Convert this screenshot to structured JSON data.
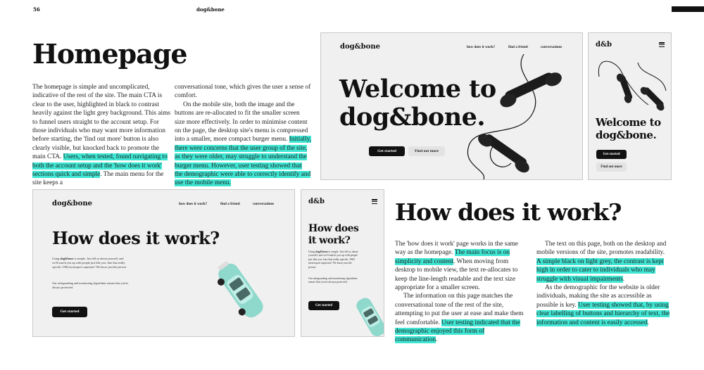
{
  "header": {
    "page_number": "56",
    "running_title": "dog&bone"
  },
  "homepage": {
    "heading": "Homepage",
    "col1": {
      "t1": "The homepage is simple and uncomplicated, indicative of the rest of the site. The main CTA is clear to the user, highlighted in black to contrast heavily against the light grey background. This aims to funnel users straight to the account setup. For those individuals who may want more information before starting, the 'find out more' button is also clearly visible, but knocked back to promote the main CTA. ",
      "h1": "Users, when tested, found navigating to both the account setup and the 'how does it work' sections quick and simple",
      "t2": ". The main menu for the site keeps a"
    },
    "col2": {
      "t1": "conversational tone, which gives the user a sense of comfort.",
      "t2": "On the mobile site, both the image and the buttons are re-allocated to fit the smaller screen size more effectively. In order to minimise content on the page, the desktop site's menu is compressed into a smaller, more compact burger menu. ",
      "h1": "Initially, there were concerns that the user group of the site, as they were older, may struggle to understand the burger menu. However, user testing showed that the demographic were able to correctly identify and use the mobile menu."
    }
  },
  "desktop_home": {
    "logo": "dog&bone",
    "nav": [
      "how does it work?",
      "find a friend",
      "conversations"
    ],
    "hero_line1": "Welcome to",
    "hero_line2": "dog&bone.",
    "primary": "Get started",
    "secondary": "Find out more"
  },
  "mobile_home": {
    "logo": "d&b",
    "hero_line1": "Welcome to",
    "hero_line2": "dog&bone.",
    "primary": "Get started",
    "secondary": "Find out more"
  },
  "desktop_how": {
    "logo": "dog&bone",
    "nav": [
      "how does it work?",
      "find a friend",
      "conversations"
    ],
    "heading": "How does it work?",
    "p1_a": "Using ",
    "p1_b": "dog&bone",
    "p1_c": " is simple. Just tell us about yourself, and we'll match you up with people just like you. Into that really specific 1982 motorsport superstar? We know just the person.",
    "p2": "Our safeguarding and monitoring algorithms ensure that you're always protected.",
    "primary": "Get started"
  },
  "mobile_how": {
    "logo": "d&b",
    "heading_line1": "How does",
    "heading_line2": "it work?",
    "p1_a": "Using ",
    "p1_b": "dog&bone",
    "p1_c": " is simple. Just tell us about yourself, and we'll match you up with people just like you. Into that really specific 1982 motorsport superstar? We know just the person.",
    "p2": "Our safeguarding and monitoring algorithms ensure that you're always protected.",
    "primary": "Get started"
  },
  "how_section": {
    "heading": "How does it work?",
    "col3": {
      "t1": "The 'how does it work' page works in the same way as the homepage. ",
      "h1": "The main focus is on simplicity and content",
      "t2": ". When moving from desktop to mobile view, the text re-allocates to keep the line-length readable and the text size appropriate for a smaller screen.",
      "t3": "The information on this page matches the conversational tone of the rest of the site, attempting to put the user at ease and make them feel comfortable. ",
      "h2": "User testing indicated that the demographic enjoyed this form of communication",
      "t4": "."
    },
    "col4": {
      "t1": "The text on this page, both on the desktop and mobile versions of the site, promotes readability. ",
      "h1": "A simple black on light grey, the contrast is kept high in order to cater to individuals who may struggle with visual impairments",
      "t2": ".",
      "t3": "As the demographic for the website is older individuals, making the site as accessible as possible is key. ",
      "h2": "User testing showed that, by using clear labelling of buttons and hierarchy of text, the information and content is easily accessed",
      "t4": "."
    }
  },
  "colors": {
    "highlight": "#3ee6d3",
    "ink": "#111111",
    "panel_bg": "#f0f0f0",
    "car": "#8fd8cc"
  }
}
